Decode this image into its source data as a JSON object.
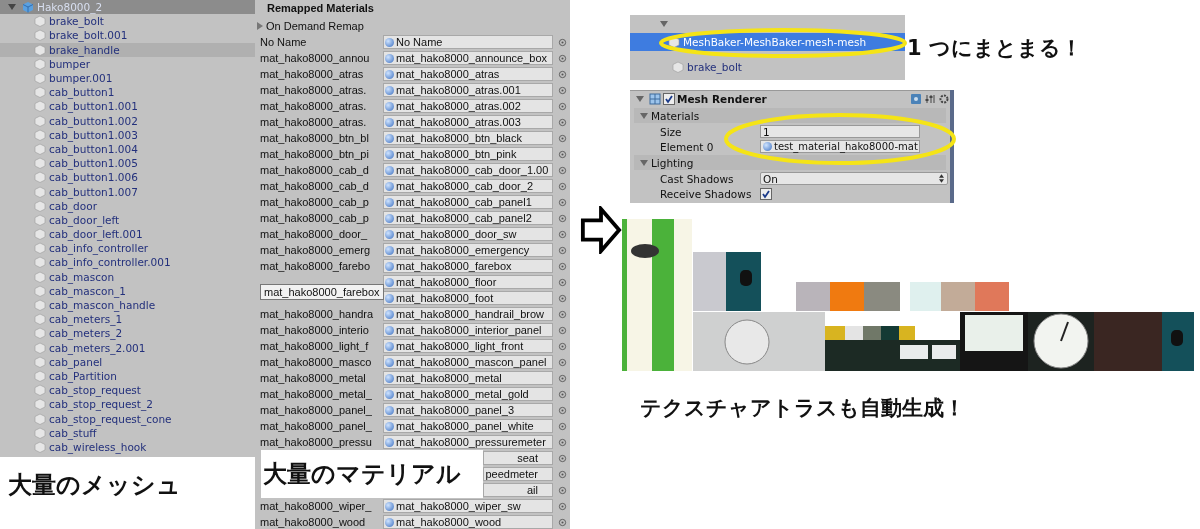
{
  "hierarchy": {
    "root": {
      "name": "Hako8000_2",
      "expanded": true,
      "selected": true,
      "children": [
        {
          "name": "brake_bolt",
          "highlighted": false
        },
        {
          "name": "brake_bolt.001",
          "highlighted": false
        },
        {
          "name": "brake_handle",
          "highlighted": true
        },
        {
          "name": "bumper",
          "highlighted": false
        },
        {
          "name": "bumper.001",
          "highlighted": false
        },
        {
          "name": "cab_button1",
          "highlighted": false
        },
        {
          "name": "cab_button1.001",
          "highlighted": false
        },
        {
          "name": "cab_button1.002",
          "highlighted": false
        },
        {
          "name": "cab_button1.003",
          "highlighted": false
        },
        {
          "name": "cab_button1.004",
          "highlighted": false
        },
        {
          "name": "cab_button1.005",
          "highlighted": false
        },
        {
          "name": "cab_button1.006",
          "highlighted": false
        },
        {
          "name": "cab_button1.007",
          "highlighted": false
        },
        {
          "name": "cab_door",
          "highlighted": false
        },
        {
          "name": "cab_door_left",
          "highlighted": false
        },
        {
          "name": "cab_door_left.001",
          "highlighted": false
        },
        {
          "name": "cab_info_controller",
          "highlighted": false
        },
        {
          "name": "cab_info_controller.001",
          "highlighted": false
        },
        {
          "name": "cab_mascon",
          "highlighted": false
        },
        {
          "name": "cab_mascon_1",
          "highlighted": false
        },
        {
          "name": "cab_mascon_handle",
          "highlighted": false
        },
        {
          "name": "cab_meters_1",
          "highlighted": false
        },
        {
          "name": "cab_meters_2",
          "highlighted": false
        },
        {
          "name": "cab_meters_2.001",
          "highlighted": false
        },
        {
          "name": "cab_panel",
          "highlighted": false
        },
        {
          "name": "cab_Partition",
          "highlighted": false
        },
        {
          "name": "cab_stop_request",
          "highlighted": false
        },
        {
          "name": "cab_stop_request_2",
          "highlighted": false
        },
        {
          "name": "cab_stop_request_cone",
          "highlighted": false
        },
        {
          "name": "cab_stuff",
          "highlighted": false
        },
        {
          "name": "cab_wireless_hook",
          "highlighted": false
        }
      ]
    }
  },
  "mesh_caption": "大量のメッシュ",
  "remapped_materials": {
    "title": "Remapped Materials",
    "on_demand_remap": {
      "label": "On Demand Remap",
      "expanded": false
    },
    "tooltip": "mat_hako8000_farebox",
    "rows": [
      {
        "kind": "normal",
        "label": "No Name",
        "value": "No Name"
      },
      {
        "kind": "normal",
        "label": "mat_hako8000_annou",
        "value": "mat_hako8000_announce_box"
      },
      {
        "kind": "normal",
        "label": "mat_hako8000_atras",
        "value": "mat_hako8000_atras"
      },
      {
        "kind": "normal",
        "label": "mat_hako8000_atras.",
        "value": "mat_hako8000_atras.001"
      },
      {
        "kind": "normal",
        "label": "mat_hako8000_atras.",
        "value": "mat_hako8000_atras.002"
      },
      {
        "kind": "normal",
        "label": "mat_hako8000_atras.",
        "value": "mat_hako8000_atras.003"
      },
      {
        "kind": "normal",
        "label": "mat_hako8000_btn_bl",
        "value": "mat_hako8000_btn_black"
      },
      {
        "kind": "normal",
        "label": "mat_hako8000_btn_pi",
        "value": "mat_hako8000_btn_pink"
      },
      {
        "kind": "normal",
        "label": "mat_hako8000_cab_d",
        "value": "mat_hako8000_cab_door_1.00"
      },
      {
        "kind": "normal",
        "label": "mat_hako8000_cab_d",
        "value": "mat_hako8000_cab_door_2"
      },
      {
        "kind": "normal",
        "label": "mat_hako8000_cab_p",
        "value": "mat_hako8000_cab_panel1"
      },
      {
        "kind": "normal",
        "label": "mat_hako8000_cab_p",
        "value": "mat_hako8000_cab_panel2"
      },
      {
        "kind": "normal",
        "label": "mat_hako8000_door_",
        "value": "mat_hako8000_door_sw"
      },
      {
        "kind": "normal",
        "label": "mat_hako8000_emerg",
        "value": "mat_hako8000_emergency"
      },
      {
        "kind": "normal",
        "label": "mat_hako8000_farebo",
        "value": "mat_hako8000_farebox"
      },
      {
        "kind": "normal",
        "value": "mat_hako8000_floor"
      },
      {
        "kind": "normal",
        "value": "mat_hako8000_foot"
      },
      {
        "kind": "normal",
        "label": "mat_hako8000_handra",
        "value": "mat_hako8000_handrail_brow"
      },
      {
        "kind": "normal",
        "label": "mat_hako8000_interio",
        "value": "mat_hako8000_interior_panel"
      },
      {
        "kind": "normal",
        "label": "mat_hako8000_light_f",
        "value": "mat_hako8000_light_front"
      },
      {
        "kind": "normal",
        "label": "mat_hako8000_masco",
        "value": "mat_hako8000_mascon_panel"
      },
      {
        "kind": "normal",
        "label": "mat_hako8000_metal",
        "value": "mat_hako8000_metal"
      },
      {
        "kind": "normal",
        "label": "mat_hako8000_metal_",
        "value": "mat_hako8000_metal_gold"
      },
      {
        "kind": "normal",
        "label": "mat_hako8000_panel_",
        "value": "mat_hako8000_panel_3"
      },
      {
        "kind": "normal",
        "label": "mat_hako8000_panel_",
        "value": "mat_hako8000_panel_white"
      },
      {
        "kind": "normal",
        "label": "mat_hako8000_pressu",
        "value": "mat_hako8000_pressuremeter"
      },
      {
        "kind": "covered",
        "value": "seat"
      },
      {
        "kind": "covered",
        "value": "peedmeter"
      },
      {
        "kind": "covered",
        "value": "ail"
      },
      {
        "kind": "normal",
        "label": "mat_hako8000_wiper_",
        "value": "mat_hako8000_wiper_sw"
      },
      {
        "kind": "normal",
        "label": "mat_hako8000_wood",
        "value": "mat_hako8000_wood"
      }
    ]
  },
  "material_caption": "大量のマテリアル",
  "combined_hierarchy": {
    "rows": [
      {
        "name": "MeshBaker-MeshBaker-mesh-mesh",
        "selected": true
      },
      {
        "name": "brake_bolt",
        "selected": false
      }
    ]
  },
  "combined_caption": "1 つにまとまる！",
  "mesh_renderer": {
    "title": "Mesh Renderer",
    "enabled": true,
    "materials": {
      "label": "Materials",
      "expanded": true,
      "size_label": "Size",
      "size": "1",
      "element_label": "Element 0",
      "element_value": "test_material_hako8000-mat"
    },
    "lighting": {
      "label": "Lighting",
      "expanded": true,
      "cast_shadows_label": "Cast Shadows",
      "cast_shadows": "On",
      "receive_shadows_label": "Receive Shadows",
      "receive_shadows": true
    }
  },
  "atlas_caption": "テクスチャアトラスも自動生成！"
}
